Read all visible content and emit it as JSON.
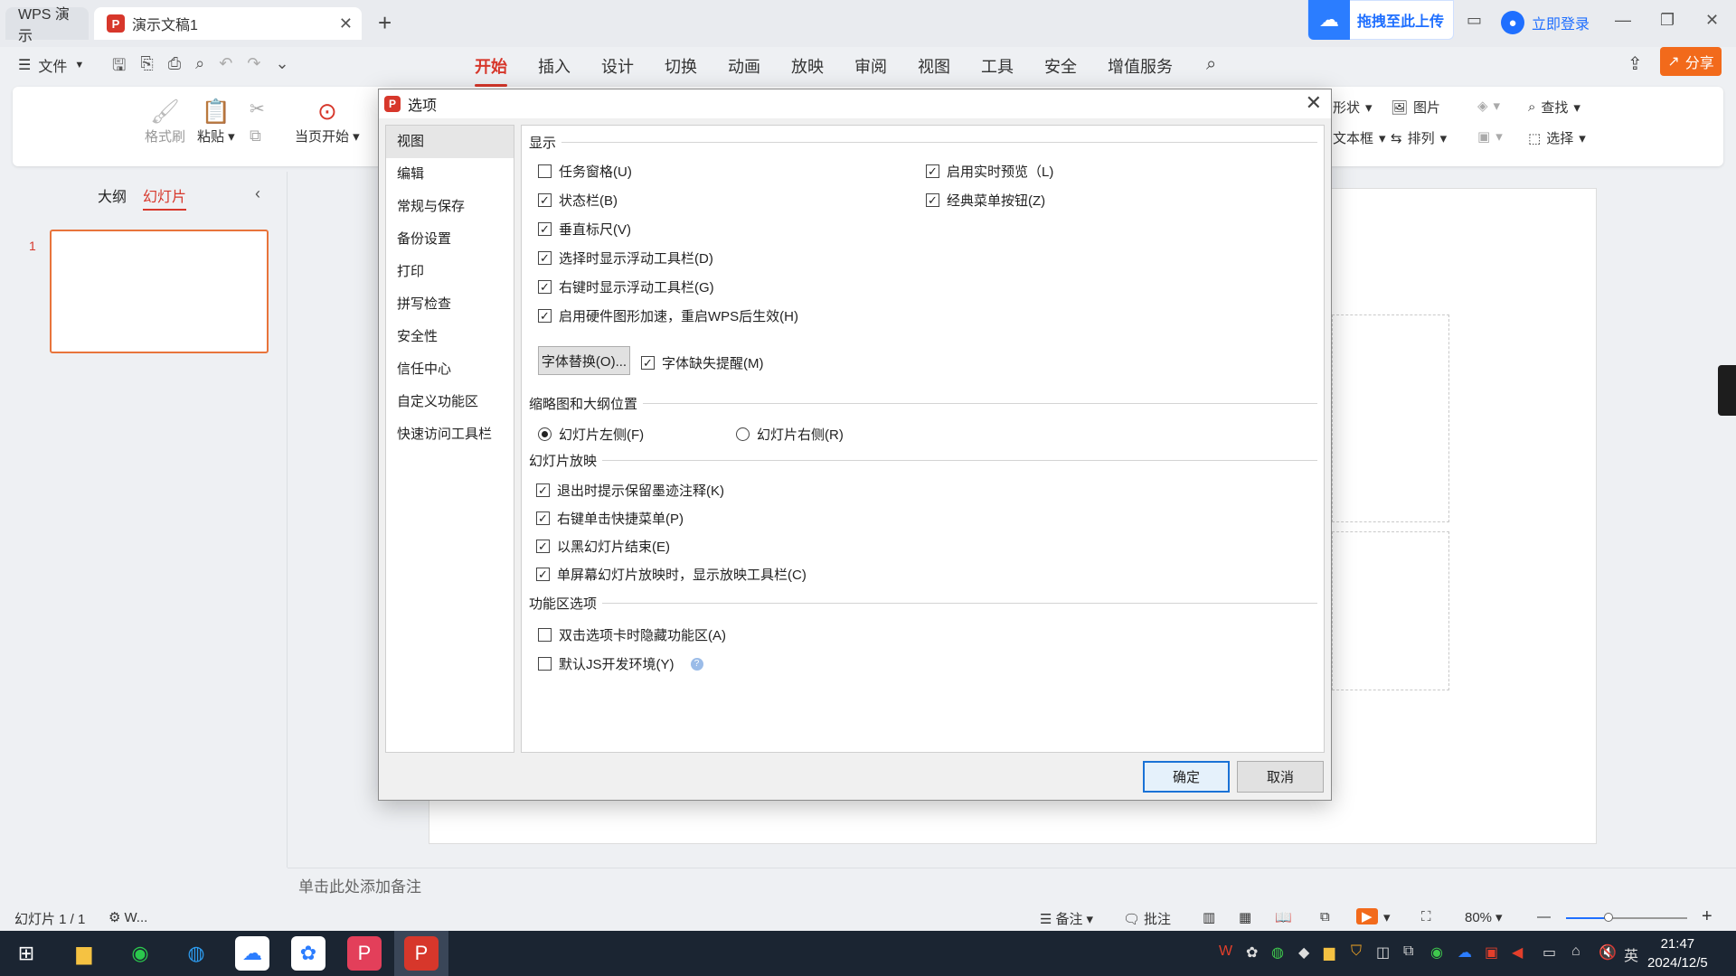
{
  "titlebar": {
    "app_tab": "WPS 演示",
    "doc_tab": "演示文稿1",
    "doc_icon_letter": "P",
    "upload_label": "拖拽至此上传",
    "login_label": "立即登录"
  },
  "menubar": {
    "file_label": "文件",
    "tabs": [
      "开始",
      "插入",
      "设计",
      "切换",
      "动画",
      "放映",
      "审阅",
      "视图",
      "工具",
      "安全",
      "增值服务"
    ],
    "active_tab": "开始",
    "share_label": "分享"
  },
  "ribbon": {
    "format_painter": "格式刷",
    "paste": "粘贴",
    "from_current": "当页开始",
    "shape_partial": "形状",
    "image": "图片",
    "find": "查找",
    "textbox_partial": "文本框",
    "arrange": "排列",
    "select": "选择"
  },
  "leftpanel": {
    "tab_outline": "大纲",
    "tab_slides": "幻灯片",
    "slide_number": "1"
  },
  "notes_placeholder": "单击此处添加备注",
  "statusbar": {
    "slide_info": "幻灯片 1 / 1",
    "theme": "W...",
    "notes": "备注",
    "comments": "批注",
    "zoom": "80%",
    "zoom_fraction": 0.35
  },
  "taskbar": {
    "time": "21:47",
    "date": "2024/12/5",
    "ime": "英"
  },
  "dialog": {
    "title": "选项",
    "nav": [
      "视图",
      "编辑",
      "常规与保存",
      "备份设置",
      "打印",
      "拼写检查",
      "安全性",
      "信任中心",
      "自定义功能区",
      "快速访问工具栏"
    ],
    "active_nav": "视图",
    "sections": {
      "display": "显示",
      "thumb_pos": "缩略图和大纲位置",
      "slideshow": "幻灯片放映",
      "ribbon_opts": "功能区选项"
    },
    "display_left": [
      {
        "label": "任务窗格(U)",
        "checked": false
      },
      {
        "label": "状态栏(B)",
        "checked": true
      },
      {
        "label": "垂直标尺(V)",
        "checked": true
      },
      {
        "label": "选择时显示浮动工具栏(D)",
        "checked": true
      },
      {
        "label": "右键时显示浮动工具栏(G)",
        "checked": true
      },
      {
        "label": "启用硬件图形加速，重启WPS后生效(H)",
        "checked": true
      }
    ],
    "display_right": [
      {
        "label": "启用实时预览（L)",
        "checked": true
      },
      {
        "label": "经典菜单按钮(Z)",
        "checked": true
      }
    ],
    "font_replace_button": "字体替换(O)...",
    "font_missing": {
      "label": "字体缺失提醒(M)",
      "checked": true
    },
    "thumb_options": [
      {
        "label": "幻灯片左侧(F)",
        "selected": true
      },
      {
        "label": "幻灯片右侧(R)",
        "selected": false
      }
    ],
    "slideshow_options": [
      {
        "label": "退出时提示保留墨迹注释(K)",
        "checked": true
      },
      {
        "label": "右键单击快捷菜单(P)",
        "checked": true
      },
      {
        "label": "以黑幻灯片结束(E)",
        "checked": true
      },
      {
        "label": "单屏幕幻灯片放映时，显示放映工具栏(C)",
        "checked": true
      }
    ],
    "ribbon_options": [
      {
        "label": "双击选项卡时隐藏功能区(A)",
        "checked": false
      },
      {
        "label": "默认JS开发环境(Y)",
        "checked": false
      }
    ],
    "ok_label": "确定",
    "cancel_label": "取消"
  }
}
